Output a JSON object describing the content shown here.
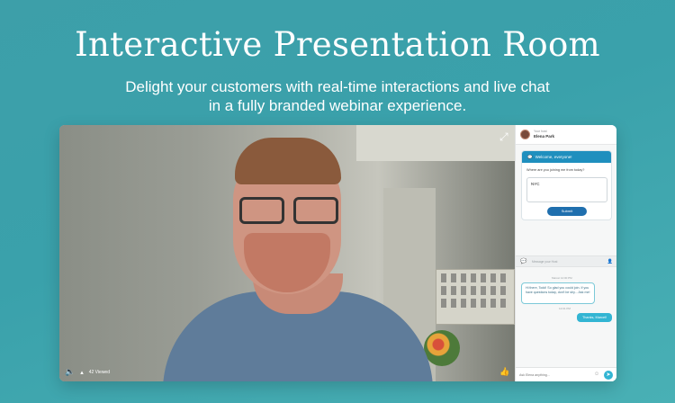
{
  "hero": {
    "title": "Interactive Presentation Room",
    "subtitle_line1": "Delight your customers with real-time interactions and live chat",
    "subtitle_line2": "in a fully branded webinar experience."
  },
  "video": {
    "viewers": "42 Viewed",
    "icons": {
      "expand": "expand-icon",
      "volume": "volume-icon",
      "viewers": "viewers-icon",
      "like": "thumbs-up-icon"
    }
  },
  "panel": {
    "host_label": "Your host",
    "host_name": "Elena Park",
    "poll": {
      "header": "Welcome, everyone!",
      "question": "Where are you joining me from today?",
      "answer_value": "NYC",
      "submit_label": "Submit"
    },
    "chat": {
      "divider_text": "Message your Host",
      "messages": [
        {
          "meta": "Marcel 12:00 PM",
          "text": "Hi there, Todd! So glad you could join. If you have questions today, don't be shy... Ask me!",
          "direction": "in"
        },
        {
          "meta": "12:01 PM",
          "text": "Thanks, Marcel!",
          "direction": "out"
        }
      ],
      "input_placeholder": "Ask Elena anything..."
    }
  },
  "colors": {
    "background": "#3da0aa",
    "poll_header": "#1f8fbe",
    "submit": "#1f6fae",
    "bubble_out": "#33b5d3"
  }
}
